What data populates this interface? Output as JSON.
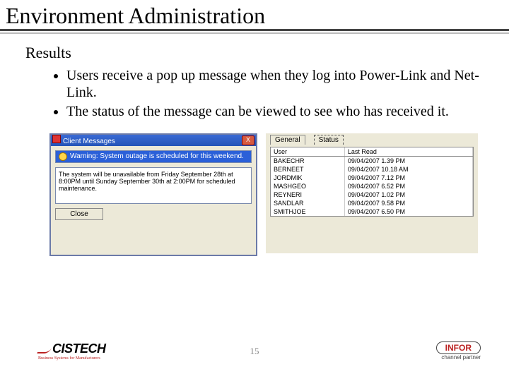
{
  "title": "Environment Administration",
  "subtitle": "Results",
  "bullets": [
    "Users receive a pop up message when they log into Power-Link and Net-Link.",
    "The status of the message can be viewed to see who has received it."
  ],
  "dialog": {
    "title": "Client Messages",
    "selected": "Warning: System outage is scheduled for this weekend.",
    "body": "The system will be unavailable from Friday September 28th at 8:00PM until Sunday September 30th at 2:00PM for scheduled maintenance.",
    "close": "Close"
  },
  "panel": {
    "tabs": {
      "general": "General",
      "status": "Status"
    },
    "cols": {
      "user": "User",
      "last": "Last Read"
    },
    "rows": [
      {
        "u": "BAKECHR",
        "t": "09/04/2007 1.39 PM"
      },
      {
        "u": "BERNEET",
        "t": "09/04/2007 10.18 AM"
      },
      {
        "u": "JORDMIK",
        "t": "09/04/2007 7.12 PM"
      },
      {
        "u": "MASHGEO",
        "t": "09/04/2007 6.52 PM"
      },
      {
        "u": "REYNERI",
        "t": "09/04/2007 1.02 PM"
      },
      {
        "u": "SANDLAR",
        "t": "09/04/2007 9.58 PM"
      },
      {
        "u": "SMITHJOE",
        "t": "09/04/2007 6.50 PM"
      }
    ]
  },
  "page": "15",
  "logos": {
    "cistech": "CISTECH",
    "cistech_tag": "Business Systems for Manufacturers",
    "infor": "INFOR",
    "cp": "channel partner"
  }
}
